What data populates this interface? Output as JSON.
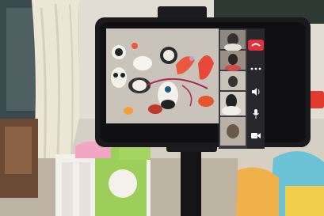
{
  "scene": {
    "description_icons": [
      "phone-on-tripod",
      "video-call-screen"
    ],
    "colors": {
      "phone_body": "#1a1a1c",
      "end_call_red": "#e0303a",
      "screen_bg": "#2a2a30",
      "wall": "#d9d4cb",
      "curtain": "#e8e2d0"
    }
  },
  "video_call": {
    "participants": [
      {
        "name": "",
        "tile": "participant-tile-1"
      },
      {
        "name": "",
        "tile": "participant-tile-2"
      },
      {
        "name": "",
        "tile": "participant-tile-3"
      },
      {
        "name": "",
        "tile": "participant-tile-4"
      },
      {
        "name": "",
        "tile": "participant-tile-5"
      }
    ],
    "controls": [
      "end-call-icon",
      "more-icon",
      "speaker-icon",
      "microphone-icon",
      "camera-icon"
    ]
  }
}
